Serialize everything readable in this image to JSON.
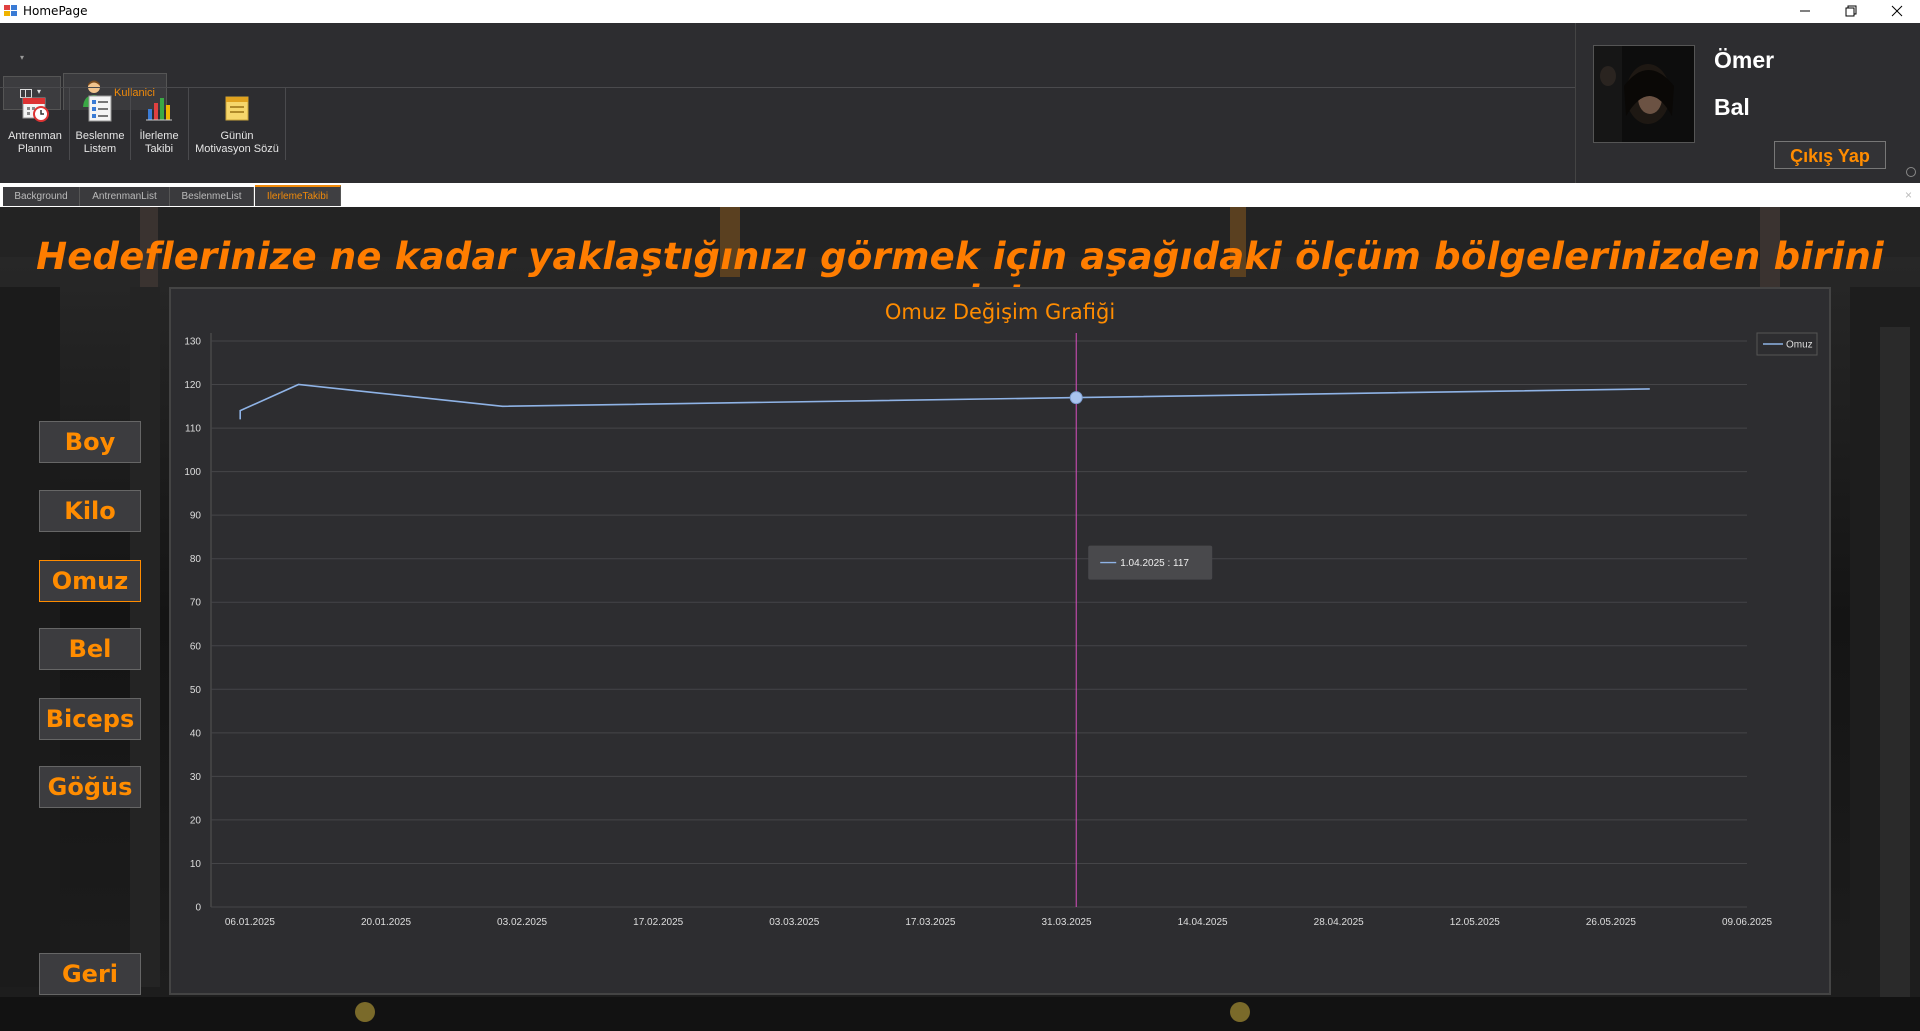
{
  "window": {
    "title": "HomePage"
  },
  "ribbon": {
    "tab_label": "Kullanici",
    "buttons": [
      {
        "label": "Antrenman\nPlanım",
        "icon": "calendar-clock-icon"
      },
      {
        "label": "Beslenme\nListem",
        "icon": "checklist-icon"
      },
      {
        "label": "İlerleme\nTakibi",
        "icon": "bar-chart-icon"
      },
      {
        "label": "Günün\nMotivasyon Sözü",
        "icon": "note-icon"
      }
    ]
  },
  "user": {
    "first_name": "Ömer",
    "last_name": "Bal",
    "logout_label": "Çıkış Yap"
  },
  "doc_tabs": [
    {
      "label": "Background",
      "active": false
    },
    {
      "label": "AntrenmanList",
      "active": false
    },
    {
      "label": "BeslenmeList",
      "active": false
    },
    {
      "label": "IlerlemeTakibi",
      "active": true
    }
  ],
  "headline": "Hedeflerinize ne kadar yaklaştığınızı görmek için aşağıdaki ölçüm bölgelerinizden birini seçin!",
  "measure_buttons": [
    {
      "label": "Boy",
      "active": false
    },
    {
      "label": "Kilo",
      "active": false
    },
    {
      "label": "Omuz",
      "active": true
    },
    {
      "label": "Bel",
      "active": false
    },
    {
      "label": "Biceps",
      "active": false
    },
    {
      "label": "Göğüs",
      "active": false
    }
  ],
  "back_label": "Geri",
  "colors": {
    "accent": "#ff8c00",
    "series": "#8fb3e6",
    "crosshair": "#d94fc0",
    "panel": "#2d2d30"
  },
  "chart_data": {
    "type": "line",
    "title": "Omuz Değişim Grafiği",
    "xlabel": "",
    "ylabel": "",
    "ylim": [
      0,
      130
    ],
    "yticks": [
      0,
      10,
      20,
      30,
      40,
      50,
      60,
      70,
      80,
      90,
      100,
      110,
      120,
      130
    ],
    "xlim": [
      "2025-01-02",
      "2025-06-09"
    ],
    "xtick_labels": [
      "06.01.2025",
      "20.01.2025",
      "03.02.2025",
      "17.02.2025",
      "03.03.2025",
      "17.03.2025",
      "31.03.2025",
      "14.04.2025",
      "28.04.2025",
      "12.05.2025",
      "26.05.2025",
      "09.06.2025"
    ],
    "grid": true,
    "legend": "top-right",
    "series": [
      {
        "name": "Omuz",
        "points": [
          {
            "x": "2025-01-05",
            "y": 112
          },
          {
            "x": "2025-01-05",
            "y": 114
          },
          {
            "x": "2025-01-11",
            "y": 120
          },
          {
            "x": "2025-02-01",
            "y": 115
          },
          {
            "x": "2025-04-01",
            "y": 117
          },
          {
            "x": "2025-05-30",
            "y": 119
          }
        ]
      }
    ],
    "crosshair": {
      "x": "2025-04-01",
      "y": 117,
      "tooltip": "1.04.2025 : 117"
    }
  }
}
